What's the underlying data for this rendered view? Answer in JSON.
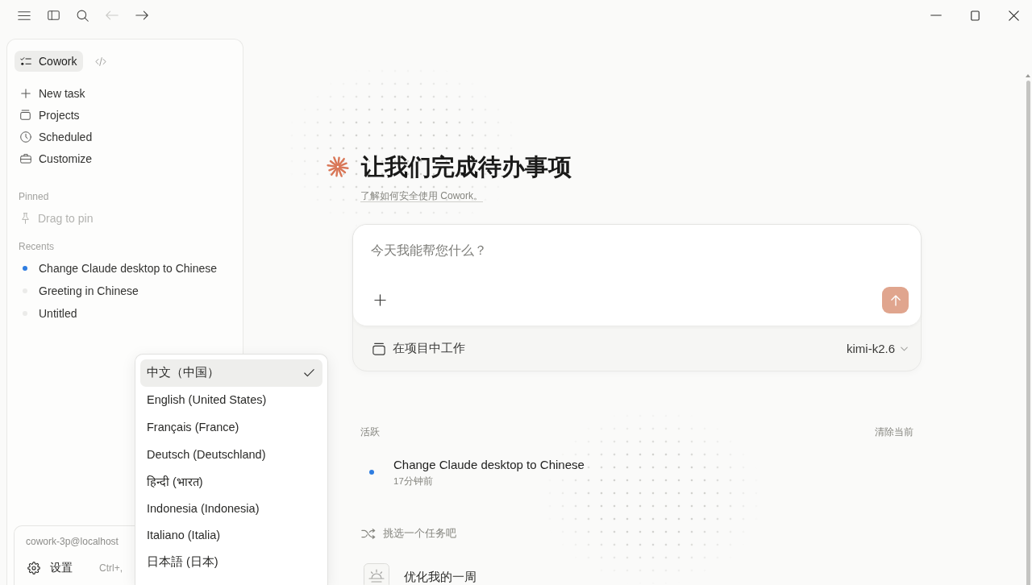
{
  "titlebar": {
    "nav": [
      {
        "kind": "back",
        "disabled": true
      },
      {
        "kind": "forward",
        "disabled": false
      }
    ]
  },
  "sidebar": {
    "mode_tabs": [
      {
        "kind": "label",
        "label": "Cowork",
        "selected": true
      },
      {
        "kind": "code",
        "selected": false
      }
    ],
    "nav_items": [
      {
        "kind": "new",
        "label": "New task"
      },
      {
        "kind": "projects",
        "label": "Projects"
      },
      {
        "kind": "scheduled",
        "label": "Scheduled"
      },
      {
        "kind": "customize",
        "label": "Customize"
      }
    ],
    "pinned": {
      "title": "Pinned",
      "hint": "Drag to pin"
    },
    "recents": {
      "title": "Recents",
      "items": [
        {
          "label": "Change Claude desktop to Chinese",
          "color": "#2f7de1"
        },
        {
          "label": "Greeting in Chinese",
          "color": "#ebebe9"
        },
        {
          "label": "Untitled",
          "color": "#ebebe9"
        }
      ]
    },
    "account": {
      "email": "cowork-3p@localhost",
      "settings_label": "设置",
      "shortcut": "Ctrl+,"
    }
  },
  "language_menu": {
    "items": [
      {
        "label": "中文（中国）",
        "selected": true
      },
      {
        "label": "English (United States)",
        "selected": false
      },
      {
        "label": "Français (France)",
        "selected": false
      },
      {
        "label": "Deutsch (Deutschland)",
        "selected": false
      },
      {
        "label": "हिन्दी (भारत)",
        "selected": false
      },
      {
        "label": "Indonesia (Indonesia)",
        "selected": false
      },
      {
        "label": "Italiano (Italia)",
        "selected": false
      },
      {
        "label": "日本語 (日本)",
        "selected": false
      }
    ]
  },
  "main": {
    "heading": "让我们完成待办事项",
    "subtitle_link": "了解如何安全使用 Cowork。",
    "prompt": {
      "placeholder": "今天我能帮您什么？",
      "send_button": {
        "disabled": true
      },
      "project_label": "在项目中工作",
      "model": "kimi-k2.6"
    },
    "active": {
      "title": "活跃",
      "clear_label": "清除当前",
      "tasks": [
        {
          "title": "Change Claude desktop to Chinese",
          "time": "17分钟前",
          "color": "#2f7de1"
        }
      ]
    },
    "suggestions": {
      "title": "挑选一个任务吧",
      "items": [
        {
          "label": "优化我的一周"
        }
      ]
    }
  }
}
